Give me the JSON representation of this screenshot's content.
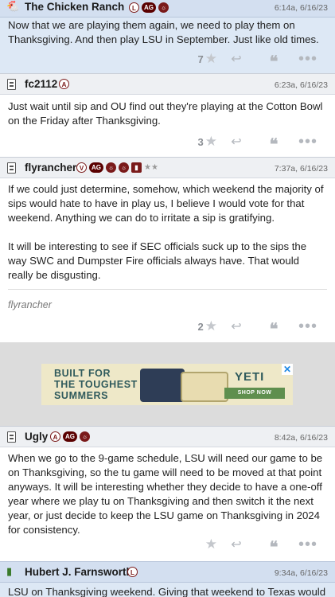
{
  "posts": [
    {
      "username": "The Chicken Ranch",
      "badges": [
        "L",
        "AG",
        "logo"
      ],
      "timestamp": "6:14a, 6/16/23",
      "paragraphs": [
        "Now that we are playing them again, we need to play them on Thanksgiving. And then play LSU in September. Just like old times."
      ],
      "stars": "7"
    },
    {
      "username": "fc2112",
      "badges": [
        "A"
      ],
      "timestamp": "6:23a, 6/16/23",
      "paragraphs": [
        "Just wait until sip and OU find out they're playing at the Cotton Bowl on the Friday after Thanksgiving."
      ],
      "stars": "3"
    },
    {
      "username": "flyrancher",
      "badges": [
        "V",
        "AG",
        "logo",
        "logo",
        "ribbon",
        "★★"
      ],
      "timestamp": "7:37a, 6/16/23",
      "paragraphs": [
        "If we could just determine, somehow, which weekend the majority of sips would hate to have in play us, I believe I would vote for that weekend. Anything we can do to irritate a sip is gratifying.",
        "It will be interesting to see if SEC officials suck up to the sips the way SWC and Dumpster Fire officials always have. That would really be disgusting."
      ],
      "signature": "flyrancher",
      "stars": "2"
    },
    {
      "username": "Ugly",
      "badges": [
        "A",
        "AG",
        "logo"
      ],
      "timestamp": "8:42a, 6/16/23",
      "paragraphs": [
        "When we go to the 9-game schedule, LSU will need our game to be on Thanksgiving, so the tu game will need to be moved at that point anyways. It will be interesting whether they decide to have a one-off year where we play tu on Thanksgiving and then switch it the next year, or just decide to keep the LSU game on Thanksgiving in 2024 for consistency."
      ],
      "stars": ""
    },
    {
      "username": "Hubert J. Farnsworth",
      "badges": [
        "L"
      ],
      "timestamp": "9:34a, 6/16/23",
      "paragraphs": [
        "LSU on Thanksgiving weekend. Giving that weekend to Texas would"
      ]
    }
  ],
  "ad": {
    "headline_1": "BUILT FOR",
    "headline_2": "THE TOUGHEST",
    "headline_3": "SUMMERS",
    "brand": "YETI",
    "cta": "SHOP NOW",
    "close": "✕"
  },
  "icons": {
    "star": "★",
    "reply": "↩",
    "quote": "❝",
    "more": "•••"
  },
  "colors": {
    "highlight_bg": "#dde8f5",
    "header_bg": "#eef0f3",
    "badge_maroon": "#5a0000",
    "ad_bg": "#eee8c8",
    "ad_text": "#2f5a5c"
  }
}
